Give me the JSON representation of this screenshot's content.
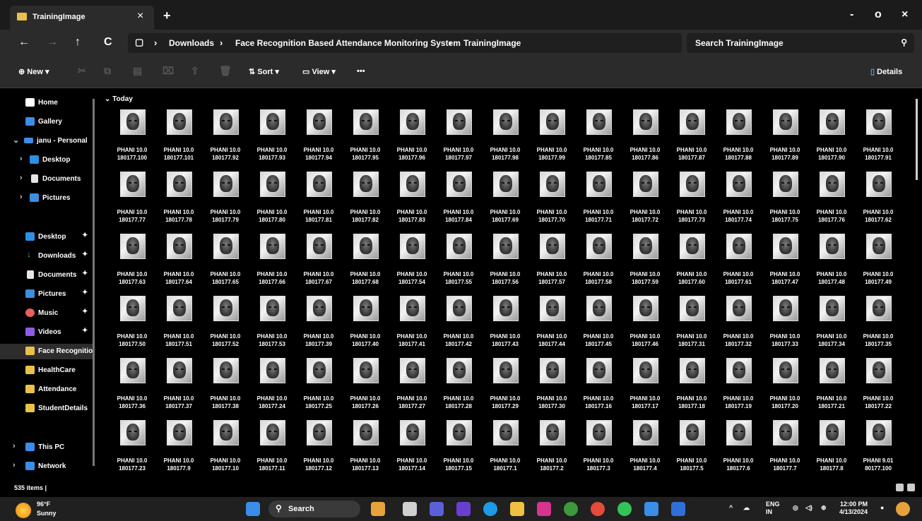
{
  "window": {
    "tab_title": "TrainingImage",
    "tab_close": "×",
    "new_tab": "+",
    "minimize": "-",
    "maximize": "o",
    "close": "×"
  },
  "nav": {
    "back": "←",
    "forward": "→",
    "up": "↑",
    "refresh": "C",
    "breadcrumbs": [
      "Downloads",
      "Face Recognition Based Attendance Monitoring System",
      "TrainingImage"
    ],
    "search_placeholder": "Search TrainingImage",
    "search_icon": "search-icon"
  },
  "toolbar": {
    "new_label": "New",
    "sort_label": "Sort",
    "view_label": "View",
    "more_label": "•••",
    "details_label": "Details"
  },
  "sidebar": {
    "items": [
      {
        "label": "Home",
        "icon": "home-icon",
        "color": "#ffffff"
      },
      {
        "label": "Gallery",
        "icon": "gallery-icon",
        "color": "#3a8de8"
      },
      {
        "label": "janu - Personal",
        "icon": "onedrive-icon",
        "color": "#3a8de8"
      },
      {
        "label": "Desktop",
        "icon": "desktop-icon",
        "color": "#2f8ee6"
      },
      {
        "label": "Documents",
        "icon": "documents-icon",
        "color": "#e6e6e6"
      },
      {
        "label": "Pictures",
        "icon": "pictures-icon",
        "color": "#3b8fe0"
      },
      {
        "label": "Desktop",
        "icon": "desktop-icon",
        "color": "#2f8ee6"
      },
      {
        "label": "Downloads",
        "icon": "downloads-icon",
        "color": "#3bbf6a"
      },
      {
        "label": "Documents",
        "icon": "documents-icon",
        "color": "#e6e6e6"
      },
      {
        "label": "Pictures",
        "icon": "pictures-icon",
        "color": "#3b8fe0"
      },
      {
        "label": "Music",
        "icon": "music-icon",
        "color": "#e8605a"
      },
      {
        "label": "Videos",
        "icon": "videos-icon",
        "color": "#8d5ce6"
      },
      {
        "label": "Face Recognitio",
        "icon": "folder-icon",
        "color": "#e9c04a"
      },
      {
        "label": "HealthCare",
        "icon": "folder-icon",
        "color": "#e9c04a"
      },
      {
        "label": "Attendance",
        "icon": "folder-icon",
        "color": "#e9c04a"
      },
      {
        "label": "StudentDetails",
        "icon": "folder-icon",
        "color": "#e9c04a"
      },
      {
        "label": "This PC",
        "icon": "pc-icon",
        "color": "#3a8de8"
      },
      {
        "label": "Network",
        "icon": "network-icon",
        "color": "#3a8de8"
      }
    ]
  },
  "content": {
    "group_label": "Today",
    "files": [
      [
        "PHANI 10.0",
        "180177.100"
      ],
      [
        "PHANI 10.0",
        "180177.101"
      ],
      [
        "PHANI 10.0",
        "180177.92"
      ],
      [
        "PHANI 10.0",
        "180177.93"
      ],
      [
        "PHANI 10.0",
        "180177.94"
      ],
      [
        "PHANI 10.0",
        "180177.95"
      ],
      [
        "PHANI 10.0",
        "180177.96"
      ],
      [
        "PHANI 10.0",
        "180177.97"
      ],
      [
        "PHANI 10.0",
        "180177.98"
      ],
      [
        "PHANI 10.0",
        "180177.99"
      ],
      [
        "PHANI 10.0",
        "180177.85"
      ],
      [
        "PHANI 10.0",
        "180177.86"
      ],
      [
        "PHANI 10.0",
        "180177.87"
      ],
      [
        "PHANI 10.0",
        "180177.88"
      ],
      [
        "PHANI 10.0",
        "180177.89"
      ],
      [
        "PHANI 10.0",
        "180177.90"
      ],
      [
        "PHANI 10.0",
        "180177.91"
      ],
      [
        "PHANI 10.0",
        "180177.77"
      ],
      [
        "PHANI 10.0",
        "180177.78"
      ],
      [
        "PHANI 10.0",
        "180177.79"
      ],
      [
        "PHANI 10.0",
        "180177.80"
      ],
      [
        "PHANI 10.0",
        "180177.81"
      ],
      [
        "PHANI 10.0",
        "180177.82"
      ],
      [
        "PHANI 10.0",
        "180177.83"
      ],
      [
        "PHANI 10.0",
        "180177.84"
      ],
      [
        "PHANI 10.0",
        "180177.69"
      ],
      [
        "PHANI 10.0",
        "180177.70"
      ],
      [
        "PHANI 10.0",
        "180177.71"
      ],
      [
        "PHANI 10.0",
        "180177.72"
      ],
      [
        "PHANI 10.0",
        "180177.73"
      ],
      [
        "PHANI 10.0",
        "180177.74"
      ],
      [
        "PHANI 10.0",
        "180177.75"
      ],
      [
        "PHANI 10.0",
        "180177.76"
      ],
      [
        "PHANI 10.0",
        "180177.62"
      ],
      [
        "PHANI 10.0",
        "180177.63"
      ],
      [
        "PHANI 10.0",
        "180177.64"
      ],
      [
        "PHANI 10.0",
        "180177.65"
      ],
      [
        "PHANI 10.0",
        "180177.66"
      ],
      [
        "PHANI 10.0",
        "180177.67"
      ],
      [
        "PHANI 10.0",
        "180177.68"
      ],
      [
        "PHANI 10.0",
        "180177.54"
      ],
      [
        "PHANI 10.0",
        "180177.55"
      ],
      [
        "PHANI 10.0",
        "180177.56"
      ],
      [
        "PHANI 10.0",
        "180177.57"
      ],
      [
        "PHANI 10.0",
        "180177.58"
      ],
      [
        "PHANI 10.0",
        "180177.59"
      ],
      [
        "PHANI 10.0",
        "180177.60"
      ],
      [
        "PHANI 10.0",
        "180177.61"
      ],
      [
        "PHANI 10.0",
        "180177.47"
      ],
      [
        "PHANI 10.0",
        "180177.48"
      ],
      [
        "PHANI 10.0",
        "180177.49"
      ],
      [
        "PHANI 10.0",
        "180177.50"
      ],
      [
        "PHANI 10.0",
        "180177.51"
      ],
      [
        "PHANI 10.0",
        "180177.52"
      ],
      [
        "PHANI 10.0",
        "180177.53"
      ],
      [
        "PHANI 10.0",
        "180177.39"
      ],
      [
        "PHANI 10.0",
        "180177.40"
      ],
      [
        "PHANI 10.0",
        "180177.41"
      ],
      [
        "PHANI 10.0",
        "180177.42"
      ],
      [
        "PHANI 10.0",
        "180177.43"
      ],
      [
        "PHANI 10.0",
        "180177.44"
      ],
      [
        "PHANI 10.0",
        "180177.45"
      ],
      [
        "PHANI 10.0",
        "180177.46"
      ],
      [
        "PHANI 10.0",
        "180177.31"
      ],
      [
        "PHANI 10.0",
        "180177.32"
      ],
      [
        "PHANI 10.0",
        "180177.33"
      ],
      [
        "PHANI 10.0",
        "180177.34"
      ],
      [
        "PHANI 10.0",
        "180177.35"
      ],
      [
        "PHANI 10.0",
        "180177.36"
      ],
      [
        "PHANI 10.0",
        "180177.37"
      ],
      [
        "PHANI 10.0",
        "180177.38"
      ],
      [
        "PHANI 10.0",
        "180177.24"
      ],
      [
        "PHANI 10.0",
        "180177.25"
      ],
      [
        "PHANI 10.0",
        "180177.26"
      ],
      [
        "PHANI 10.0",
        "180177.27"
      ],
      [
        "PHANI 10.0",
        "180177.28"
      ],
      [
        "PHANI 10.0",
        "180177.29"
      ],
      [
        "PHANI 10.0",
        "180177.30"
      ],
      [
        "PHANI 10.0",
        "180177.16"
      ],
      [
        "PHANI 10.0",
        "180177.17"
      ],
      [
        "PHANI 10.0",
        "180177.18"
      ],
      [
        "PHANI 10.0",
        "180177.19"
      ],
      [
        "PHANI 10.0",
        "180177.20"
      ],
      [
        "PHANI 10.0",
        "180177.21"
      ],
      [
        "PHANI 10.0",
        "180177.22"
      ],
      [
        "PHANI 10.0",
        "180177.23"
      ],
      [
        "PHANI 10.0",
        "180177.9"
      ],
      [
        "PHANI 10.0",
        "180177.10"
      ],
      [
        "PHANI 10.0",
        "180177.11"
      ],
      [
        "PHANI 10.0",
        "180177.12"
      ],
      [
        "PHANI 10.0",
        "180177.13"
      ],
      [
        "PHANI 10.0",
        "180177.14"
      ],
      [
        "PHANI 10.0",
        "180177.15"
      ],
      [
        "PHANI 10.0",
        "180177.1"
      ],
      [
        "PHANI 10.0",
        "180177.2"
      ],
      [
        "PHANI 10.0",
        "180177.3"
      ],
      [
        "PHANI 10.0",
        "180177.4"
      ],
      [
        "PHANI 10.0",
        "180177.5"
      ],
      [
        "PHANI 10.0",
        "180177.6"
      ],
      [
        "PHANI 10.0",
        "180177.7"
      ],
      [
        "PHANI 10.0",
        "180177.8"
      ],
      [
        "PHANI 9.01",
        "80177.100"
      ]
    ]
  },
  "status": {
    "item_count": "535 items  |"
  },
  "taskbar": {
    "weather_temp": "96°F",
    "weather_cond": "Sunny",
    "search_placeholder": "Search",
    "lang_top": "ENG",
    "lang_bottom": "IN",
    "time": "12:00 PM",
    "date": "4/13/2024"
  }
}
